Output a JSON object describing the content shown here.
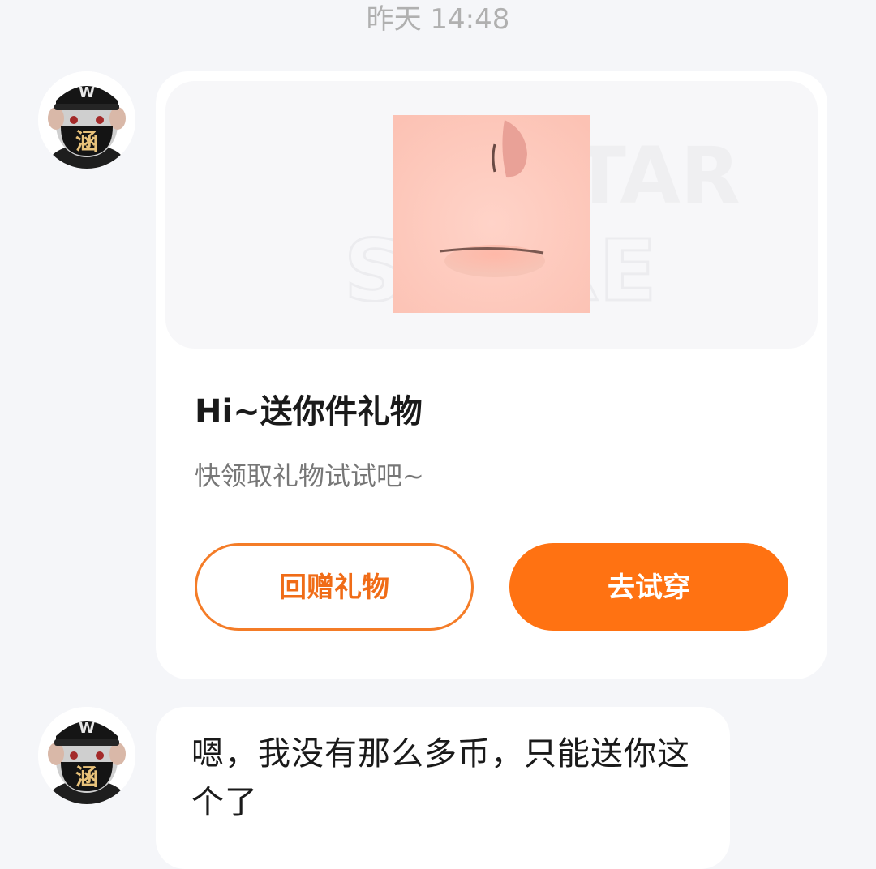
{
  "chat": {
    "timestamp": "昨天 14:48"
  },
  "avatar": {
    "badge_char": "涵",
    "cap_logo": "W"
  },
  "gift_card": {
    "watermark_line1": "AVATAR",
    "watermark_line2": "STORE",
    "title": "Hi~送你件礼物",
    "subtitle": "快领取礼物试试吧~",
    "return_gift_button": "回赠礼物",
    "try_on_button": "去试穿"
  },
  "message": {
    "text": "嗯，我没有那么多币，只能送你这个了"
  },
  "colors": {
    "accent": "#ff7212",
    "page_bg": "#f5f6f9",
    "card_bg": "#ffffff"
  },
  "icons": {
    "avatar": "masked-cap-avatar-icon",
    "gift_thumbnail": "face-makeup-thumbnail"
  }
}
